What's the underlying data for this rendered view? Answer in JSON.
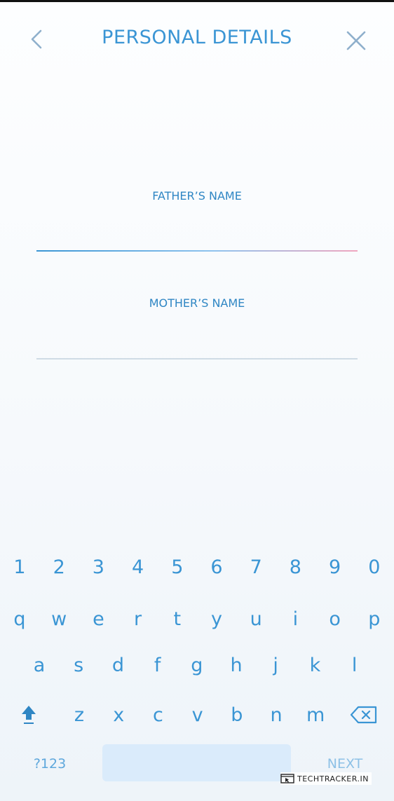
{
  "header": {
    "title": "PERSONAL DETAILS",
    "back_icon": "chevron-left-icon",
    "close_icon": "close-icon"
  },
  "form": {
    "father_label": "FATHER’S NAME",
    "father_value": "",
    "mother_label": "MOTHER’S NAME",
    "mother_value": ""
  },
  "keyboard": {
    "row1": [
      "1",
      "2",
      "3",
      "4",
      "5",
      "6",
      "7",
      "8",
      "9",
      "0"
    ],
    "row2": [
      "q",
      "w",
      "e",
      "r",
      "t",
      "y",
      "u",
      "i",
      "o",
      "p"
    ],
    "row3": [
      "a",
      "s",
      "d",
      "f",
      "g",
      "h",
      "j",
      "k",
      "l"
    ],
    "row4": [
      "z",
      "x",
      "c",
      "v",
      "b",
      "n",
      "m"
    ],
    "shift_icon": "shift-arrow-icon",
    "backspace_icon": "backspace-icon",
    "mode_label": "?123",
    "next_label": "NEXT"
  },
  "watermark": {
    "text": "TECHTRACKER.IN"
  },
  "colors": {
    "accent": "#3a95d4",
    "underline_start": "#3a95d4",
    "underline_end": "#f0a6bf",
    "space_key": "#daebfb"
  }
}
